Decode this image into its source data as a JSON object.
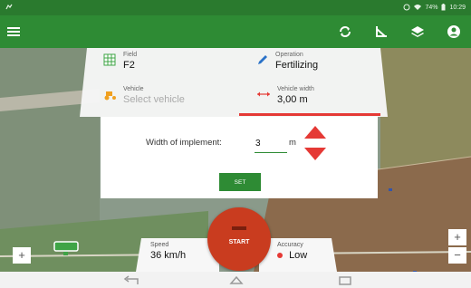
{
  "status_bar": {
    "battery": "74%",
    "time": "10:29"
  },
  "toolbar": {
    "menu_icon": "menu-icon",
    "icons": [
      "sync-icon",
      "angle-icon",
      "layers-icon",
      "account-icon"
    ]
  },
  "info": {
    "field_label": "Field",
    "field_value": "F2",
    "operation_label": "Operation",
    "operation_value": "Fertilizing",
    "vehicle_label": "Vehicle",
    "vehicle_placeholder": "Select vehicle",
    "vehicle_width_label": "Vehicle width",
    "vehicle_width_value": "3,00 m"
  },
  "dialog": {
    "label": "Width of implement:",
    "input_value": "3",
    "unit": "m",
    "set_label": "SET"
  },
  "bottom": {
    "speed_label": "Speed",
    "speed_value": "36 km/h",
    "start_label": "START",
    "accuracy_label": "Accuracy",
    "accuracy_value": "Low"
  },
  "colors": {
    "primary": "#2e8b34",
    "status_bar": "#2a7a2e",
    "start": "#c93c1f",
    "accent_red": "#e53935"
  }
}
